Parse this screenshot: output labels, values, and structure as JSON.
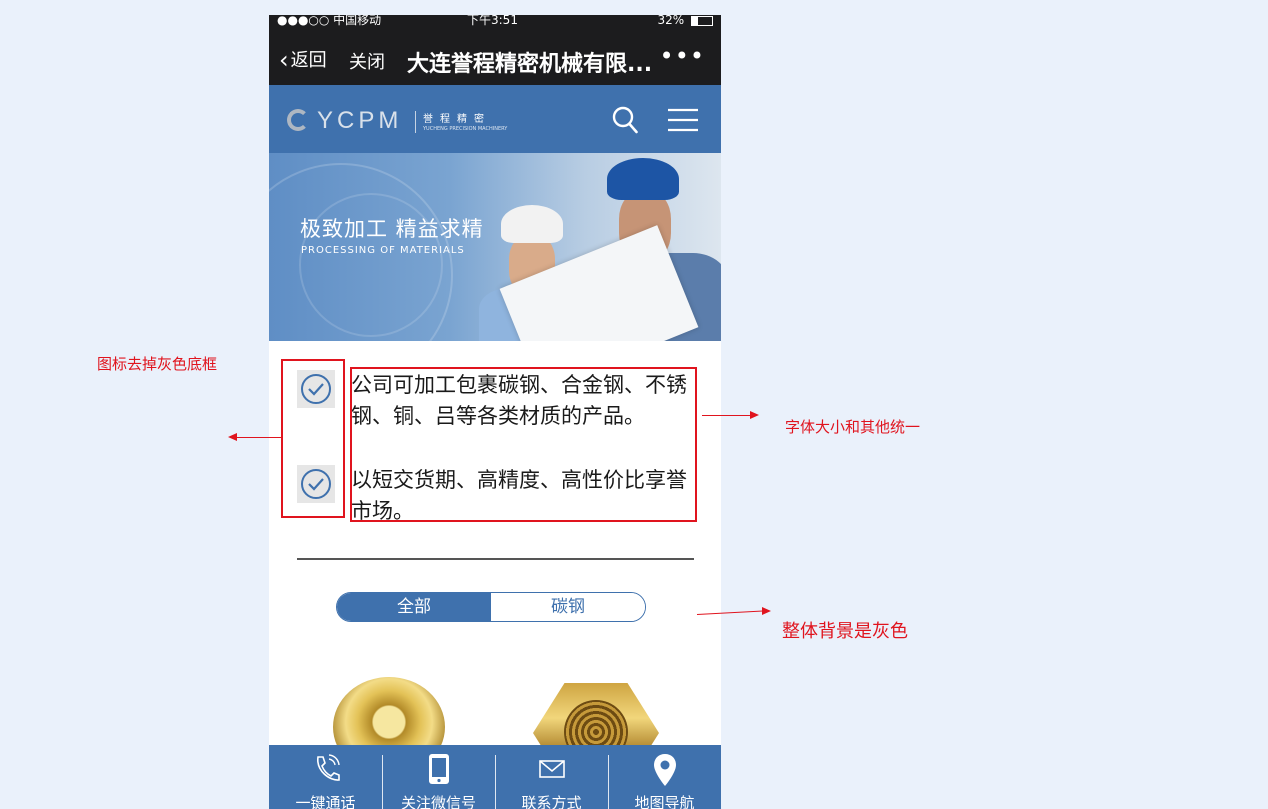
{
  "status_bar": {
    "carrier": "●●●○○ 中国移动",
    "time": "下午3:51",
    "battery": "32%"
  },
  "nav": {
    "back_label": "返回",
    "close_label": "关闭",
    "title": "大连誉程精密机械有限...",
    "more_label": "•••"
  },
  "header": {
    "logo_text": "YCPM",
    "logo_cn": "誉程精密",
    "logo_en": "YUCHENG PRECISION MACHINERY"
  },
  "banner": {
    "title": "极致加工 精益求精",
    "subtitle": "PROCESSING OF MATERIALS"
  },
  "features": [
    {
      "text": "公司可加工包裹碳钢、合金钢、不锈钢、铜、吕等各类材质的产品。"
    },
    {
      "text": "以短交货期、高精度、高性价比享誉市场。"
    }
  ],
  "tabs": [
    {
      "label": "全部",
      "active": true
    },
    {
      "label": "碳钢",
      "active": false
    }
  ],
  "bottom_nav": [
    {
      "label": "一键通话",
      "icon": "phone-icon"
    },
    {
      "label": "关注微信号",
      "icon": "mobile-icon"
    },
    {
      "label": "联系方式",
      "icon": "mail-icon"
    },
    {
      "label": "地图导航",
      "icon": "map-pin-icon"
    }
  ],
  "annotations": {
    "icon_note": "图标去掉灰色底框",
    "font_note": "字体大小和其他统一",
    "bg_note": "整体背景是灰色"
  },
  "colors": {
    "brand_blue": "#3f71ad",
    "annotation_red": "#e0141e",
    "page_bg": "#eaf1fb"
  }
}
